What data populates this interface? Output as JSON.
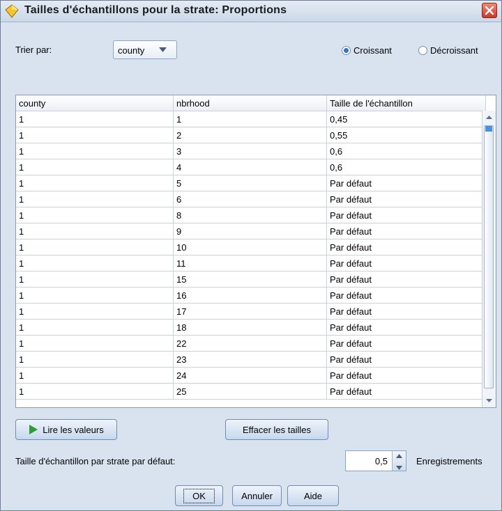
{
  "window": {
    "title": "Tailles d'échantillons pour la strate: Proportions",
    "accent": "#2f74d0"
  },
  "sort": {
    "label": "Trier par:",
    "selected": "county",
    "ascending_label": "Croissant",
    "descending_label": "Décroissant",
    "ascending_selected": true
  },
  "table": {
    "columns": [
      "county",
      "nbrhood",
      "Taille de l'échantillon"
    ],
    "rows": [
      [
        "1",
        "1",
        "0,45"
      ],
      [
        "1",
        "2",
        "0,55"
      ],
      [
        "1",
        "3",
        "0,6"
      ],
      [
        "1",
        "4",
        "0,6"
      ],
      [
        "1",
        "5",
        "Par défaut"
      ],
      [
        "1",
        "6",
        "Par défaut"
      ],
      [
        "1",
        "8",
        "Par défaut"
      ],
      [
        "1",
        "9",
        "Par défaut"
      ],
      [
        "1",
        "10",
        "Par défaut"
      ],
      [
        "1",
        "11",
        "Par défaut"
      ],
      [
        "1",
        "15",
        "Par défaut"
      ],
      [
        "1",
        "16",
        "Par défaut"
      ],
      [
        "1",
        "17",
        "Par défaut"
      ],
      [
        "1",
        "18",
        "Par défaut"
      ],
      [
        "1",
        "22",
        "Par défaut"
      ],
      [
        "1",
        "23",
        "Par défaut"
      ],
      [
        "1",
        "24",
        "Par défaut"
      ],
      [
        "1",
        "25",
        "Par défaut"
      ]
    ]
  },
  "buttons": {
    "read_values": "Lire les valeurs",
    "clear_sizes": "Effacer les tailles",
    "ok": "OK",
    "cancel": "Annuler",
    "help": "Aide"
  },
  "default_size": {
    "label": "Taille d'échantillon par strate par défaut:",
    "value": "0,5",
    "units": "Enregistrements"
  }
}
